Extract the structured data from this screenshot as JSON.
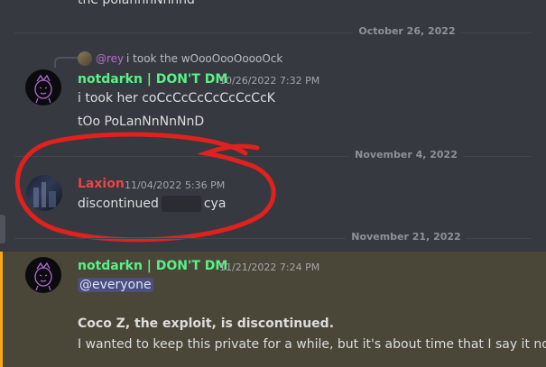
{
  "top_fragment": "the polannnNnnnd",
  "dividers": [
    {
      "label": "October 26, 2022"
    },
    {
      "label": "November 4, 2022"
    },
    {
      "label": "November 21, 2022"
    }
  ],
  "messages": [
    {
      "reply": {
        "name": "@rey",
        "text": "i took the wOooOooOoooOck"
      },
      "username": "notdarkn | DON'T DM",
      "timestamp": "10/26/2022 7:32 PM",
      "lines": [
        "i took her coCcCcCcCcCcCcCcK",
        "tOo PoLanNnNnNnD"
      ]
    },
    {
      "username": "Laxion",
      "timestamp": "11/04/2022 5:36 PM",
      "text_before": "discontinued",
      "text_after": "cya"
    },
    {
      "username": "notdarkn | DON'T DM",
      "timestamp": "11/21/2022 7:24 PM",
      "mention": "@everyone",
      "bold_line": "Coco Z, the exploit, is discontinued.",
      "line": "I wanted to keep this private for a while, but it's about time that I say it now."
    }
  ],
  "colors": {
    "background": "#36393f",
    "username_green": "#57f287",
    "username_red": "#ed4245",
    "mention_bg": "#4b4f7c",
    "highlight_bar": "#faa81a",
    "annotation": "#e0211f"
  },
  "icons": [
    "notdarkn-avatar",
    "laxion-avatar",
    "rey-avatar"
  ]
}
